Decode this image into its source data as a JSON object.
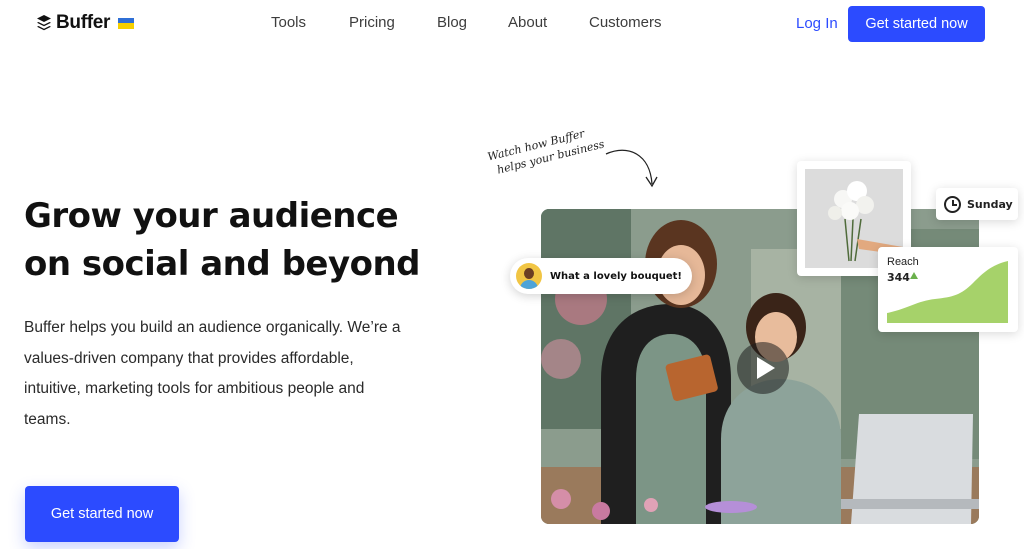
{
  "brand": {
    "name": "Buffer",
    "flag_colors": [
      "#2f6fd6",
      "#f6d000"
    ]
  },
  "nav": {
    "items": [
      "Tools",
      "Pricing",
      "Blog",
      "About",
      "Customers"
    ]
  },
  "header": {
    "login": "Log In",
    "cta": "Get started now"
  },
  "hero": {
    "title_line1": "Grow your audience",
    "title_line2": "on social and beyond",
    "description": "Buffer helps you build an audience organically. We’re a values-driven company that provides affordable, intuitive, marketing tools for ambitious people and teams.",
    "cta": "Get started now"
  },
  "media": {
    "note_line1": "Watch how Buffer",
    "note_line2": "helps your business",
    "comment": "What a lovely bouquet!",
    "schedule_day": "Sunday",
    "reach_label": "Reach",
    "reach_value": "344",
    "reach_trend": "up"
  },
  "colors": {
    "accent": "#2c4bff",
    "reach_green": "#a6d26a"
  }
}
